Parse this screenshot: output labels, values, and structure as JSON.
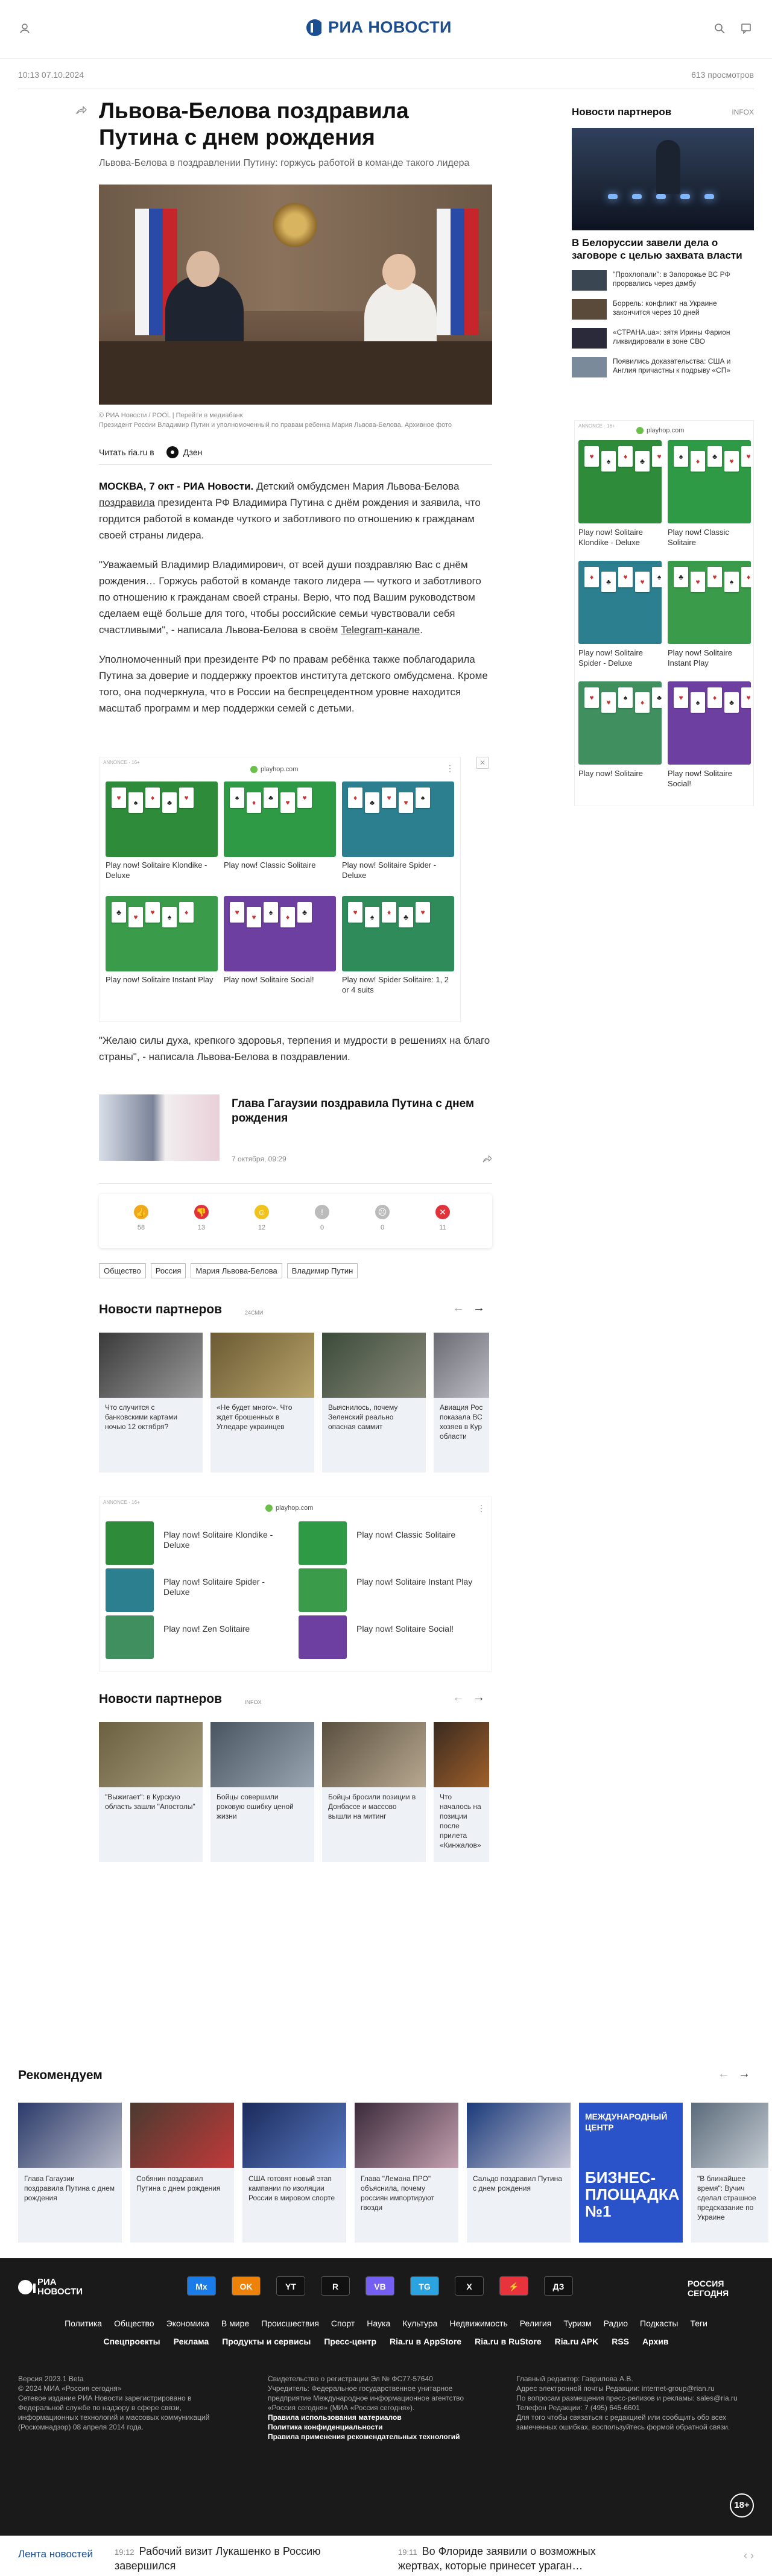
{
  "header": {
    "logo_text": "РИА НОВОСТИ",
    "icons": [
      "user-icon",
      "search-icon",
      "chat-icon"
    ]
  },
  "meta": {
    "datetime": "10:13 07.10.2024",
    "views": "613 просмотров"
  },
  "article": {
    "title": "Львова-Белова поздравила Путина с днем рождения",
    "subtitle": "Львова-Белова в поздравлении Путину: горжусь работой в команде такого лидера",
    "caption_credit": "© РИА Новости / POOL | Перейти в медиабанк",
    "caption_text": "Президент России Владимир Путин и уполномоченный по правам ребенка Мария Львова-Белова. Архивное фото",
    "read_label": "Читать ria.ru в",
    "dzen_label": "Дзен",
    "p1_lead": "МОСКВА, 7 окт - РИА Новости.",
    "p1_text": " Детский омбудсмен Мария Львова-Белова ",
    "p1_link": "поздравила",
    "p1_rest": " президента РФ Владимира Путина с днём рождения и заявила, что гордится работой в команде чуткого и заботливого по отношению к гражданам своей страны лидера.",
    "p2_text": "\"Уважаемый Владимир Владимирович, от всей души поздравляю Вас с днём рождения… Горжусь работой в команде такого лидера — чуткого и заботливого по отношению к гражданам своей страны. Верю, что под Вашим руководством сделаем ещё больше для того, чтобы российские семьи чувствовали себя счастливыми\", - написала Львова-Белова в своём ",
    "p2_link": "Telegram-канале",
    "p2_end": ".",
    "p3_text": "Уполномоченный при президенте РФ по правам ребёнка также поблагодарила Путина за доверие и поддержку проектов института детского омбудсмена. Кроме того, она подчеркнула, что в России на беспрецедентном уровне находится масштаб программ и мер поддержки семей с детьми.",
    "p4_text": "\"Желаю силы духа, крепкого здоровья, терпения и мудрости в решениях на благо страны\", - написала Львова-Белова в поздравлении."
  },
  "ad_inline": {
    "label": "ANNONCE · 16+",
    "host": "playhop.com",
    "games": [
      {
        "name": "Play now! Solitaire Klondike - Deluxe",
        "color": "#2e8b3a"
      },
      {
        "name": "Play now! Classic Solitaire",
        "color": "#2f9a45"
      },
      {
        "name": "Play now! Solitaire Spider - Deluxe",
        "color": "#2b7f8f"
      },
      {
        "name": "Play now! Solitaire Instant Play",
        "color": "#3a9b4a"
      },
      {
        "name": "Play now! Solitaire Social!",
        "color": "#6d3fa0"
      },
      {
        "name": "Play now! Spider Solitaire: 1, 2 or 4 suits",
        "color": "#2f8c5a"
      }
    ]
  },
  "related": {
    "title": "Глава Гагаузии поздравила Путина с днем рождения",
    "date": "7 октября, 09:29"
  },
  "reactions": [
    {
      "icon": "like-icon",
      "count": "58",
      "color": "#f0a91c"
    },
    {
      "icon": "dislike-icon",
      "count": "13",
      "color": "#e0333c"
    },
    {
      "icon": "smile-icon",
      "count": "12",
      "color": "#f0c21c"
    },
    {
      "icon": "surprise-icon",
      "count": "0",
      "color": "#bbbbbb"
    },
    {
      "icon": "sad-icon",
      "count": "0",
      "color": "#bbbbbb"
    },
    {
      "icon": "angry-icon",
      "count": "11",
      "color": "#e0333c"
    }
  ],
  "tags": [
    "Общество",
    "Россия",
    "Мария Львова-Белова",
    "Владимир Путин"
  ],
  "partners1": {
    "title": "Новости партнеров",
    "source": "24СМИ",
    "cards": [
      "Что случится с банковскими картами ночью 12 октября?",
      "«Не будет много». Что ждет брошенных в Угледаре украинцев",
      "Выяснилось, почему Зеленский реально опасная саммит",
      "Авиация Рос показала ВС хозяев в Кур области"
    ]
  },
  "ad_list": {
    "label": "ANNONCE · 16+",
    "host": "playhop.com",
    "items": [
      "Play now! Solitaire Klondike - Deluxe",
      "Play now! Classic Solitaire",
      "Play now! Solitaire Spider - Deluxe",
      "Play now! Solitaire Instant Play",
      "Play now! Zen Solitaire",
      "Play now! Solitaire Social!"
    ]
  },
  "partners2": {
    "title": "Новости партнеров",
    "source": "INFOX",
    "cards": [
      "\"Выжигает\": в Курскую область зашли \"Апостолы\"",
      "Бойцы совершили роковую ошибку ценой жизни",
      "Бойцы бросили позиции в Донбассе и массово вышли на митинг",
      "Что началось на позиции после прилета «Кинжалов»"
    ]
  },
  "sidebar": {
    "title": "Новости партнеров",
    "source": "INFOX",
    "main_title": "В Белоруссии завели дела о заговоре с целью захвата власти",
    "items": [
      "\"Прохлопали\": в Запорожье ВС РФ прорвались через дамбу",
      "Боррель: конфликт на Украине закончится через 10 дней",
      "«СТРАНА.ua»: зятя Ирины Фарион ликвидировали в зоне СВО",
      "Появились доказательства: США и Англия причастны к подрыву «СП»"
    ],
    "ad_host": "playhop.com",
    "ad_games": [
      "Play now! Solitaire Klondike - Deluxe",
      "Play now! Classic Solitaire",
      "Play now! Solitaire Spider - Deluxe",
      "Play now! Solitaire Instant Play",
      "Play now! Solitaire",
      "Play now! Solitaire Social!"
    ]
  },
  "recommend": {
    "title": "Рекомендуем",
    "cards": [
      "Глава Гагаузии поздравила Путина с днем рождения",
      "Собянин поздравил Путина с днем рождения",
      "США готовят новый этап кампании по изоляции России в мировом спорте",
      "Глава \"Лемана ПРО\" объяснила, почему россиян импортируют гвозди",
      "Сальдо поздравил Путина с днем рождения",
      "",
      "\"В ближайшее время\": Вучич сделал страшное предсказание по Украине"
    ],
    "promo_top": "МЕЖДУНАРОДНЫЙ ЦЕНТР",
    "promo_big": "БИЗНЕС-ПЛОЩАДКА №1"
  },
  "footer": {
    "logo_text": "РИА НОВОСТИ",
    "partner_logo": "РОССИЯ СЕГОДНЯ",
    "social": [
      "Mx",
      "OK",
      "YT",
      "R",
      "VB",
      "TG",
      "X",
      "⚡",
      "ДЗ"
    ],
    "nav": [
      "Политика",
      "Общество",
      "Экономика",
      "В мире",
      "Происшествия",
      "Спорт",
      "Наука",
      "Культура",
      "Недвижимость",
      "Религия",
      "Туризм",
      "Радио",
      "Подкасты",
      "Теги"
    ],
    "nav2": [
      "Спецпроекты",
      "Реклама",
      "Продукты и сервисы",
      "Пресс-центр",
      "Ria.ru в AppStore",
      "Ria.ru в RuStore",
      "Ria.ru APK",
      "RSS",
      "Архив"
    ],
    "col1": "Версия 2023.1 Beta\n© 2024 МИА «Россия сегодня»\nСетевое издание РИА Новости зарегистрировано в Федеральной службе по надзору в сфере связи, информационных технологий и массовых коммуникаций (Роскомнадзор) 08 апреля 2014 года.",
    "col2": "Свидетельство о регистрации Эл № ФС77-57640\nУчредитель: Федеральное государственное унитарное предприятие Международное информационное агентство «Россия сегодня» (МИА «Россия сегодня»).",
    "col2_links": [
      "Правила использования материалов",
      "Политика конфиденциальности",
      "Правила применения рекомендательных технологий"
    ],
    "col3": "Главный редактор: Гаврилова А.В.\nАдрес электронной почты Редакции: internet-group@rian.ru\nПо вопросам размещения пресс-релизов и рекламы: sales@ria.ru\nТелефон Редакции: 7 (495) 645-6601\nДля того чтобы связаться с редакцией или сообщить обо всех замеченных ошибках, воспользуйтесь формой обратной связи.",
    "age": "18+"
  },
  "feed": {
    "label": "Лента новостей",
    "items": [
      {
        "time": "19:12",
        "text": "Рабочий визит Лукашенко в Россию завершился"
      },
      {
        "time": "19:11",
        "text": "Во Флориде заявили о возможных жертвах, которые принесет ураган…"
      }
    ]
  }
}
